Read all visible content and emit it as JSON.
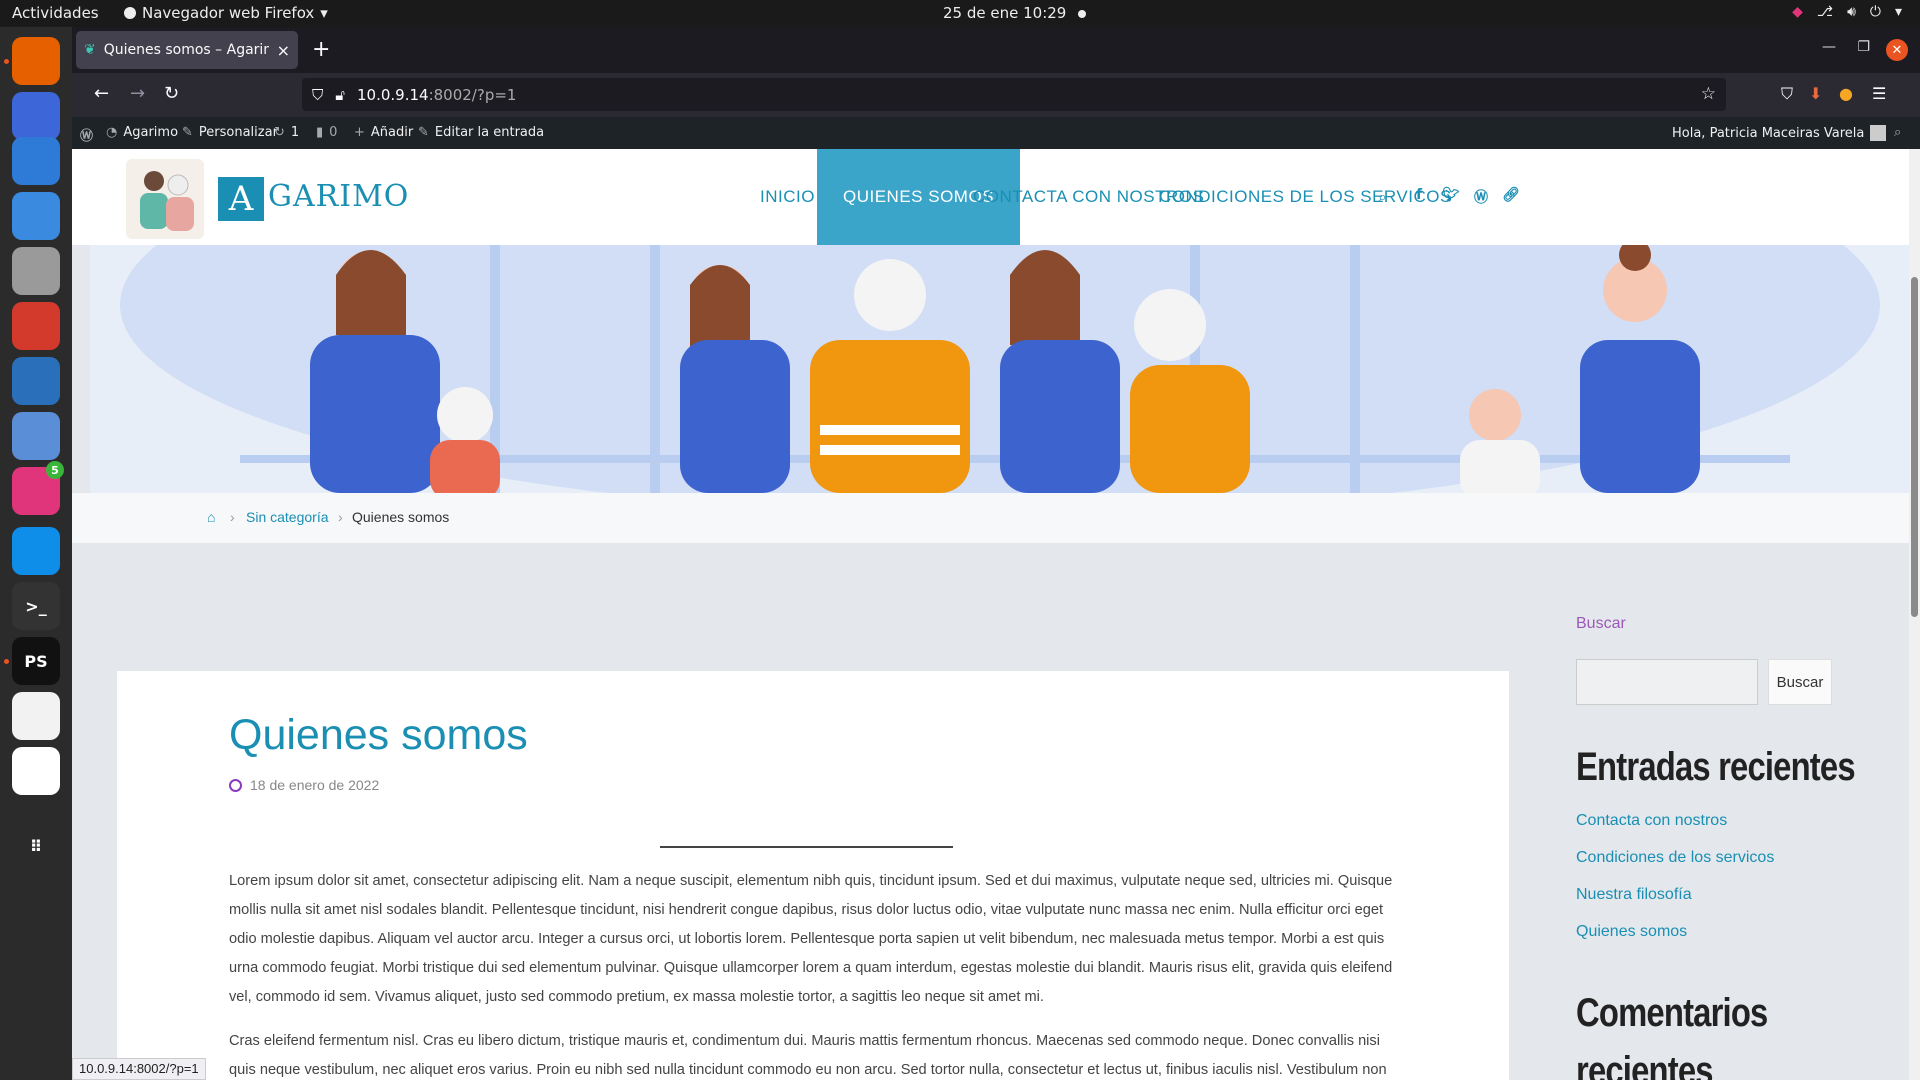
{
  "topbar": {
    "activities": "Actividades",
    "app_name": "Navegador web Firefox",
    "app_arrow": "▾",
    "clock": "25 de ene  10:29"
  },
  "dock": {
    "items": [
      {
        "name": "firefox",
        "label": "",
        "color": "#e66000"
      },
      {
        "name": "screenshot",
        "label": "",
        "color": "#3d66d8"
      },
      {
        "name": "document-viewer",
        "label": "",
        "color": "#2d7bd6"
      },
      {
        "name": "software-center",
        "label": "",
        "color": "#3a8be0"
      },
      {
        "name": "files",
        "label": "",
        "color": "#9a9a9a"
      },
      {
        "name": "chrome",
        "label": "",
        "color": "#d33a2c"
      },
      {
        "name": "system-monitor",
        "label": "",
        "color": "#2a6fb9"
      },
      {
        "name": "virtualbox",
        "label": "",
        "color": "#5a8ed6"
      },
      {
        "name": "jetbrains-toolbox",
        "label": "",
        "color": "#e0357a",
        "badge": "5"
      },
      {
        "name": "teamviewer",
        "label": "",
        "color": "#0e8ee9"
      },
      {
        "name": "terminal",
        "label": ">_",
        "color": "#333"
      },
      {
        "name": "phpstorm",
        "label": "PS",
        "color": "#111"
      },
      {
        "name": "text-editor",
        "label": "",
        "color": "#f2f2f2"
      },
      {
        "name": "android-studio",
        "label": "",
        "color": "#ffffff"
      },
      {
        "name": "app-grid",
        "label": "⠿",
        "color": "#2b2b2b"
      }
    ]
  },
  "browser": {
    "tab_title": "Quienes somos – Agarimo",
    "tab_close": "×",
    "new_tab": "+",
    "url_host": "10.0.9.14",
    "url_rest": ":8002/?p=1",
    "status_url": "10.0.9.14:8002/?p=1"
  },
  "wpbar": {
    "site": "Agarimo",
    "customize": "Personalizar",
    "updates": "1",
    "comments": "0",
    "add": "Añadir",
    "edit": "Editar la entrada",
    "greeting": "Hola, Patricia Maceiras Varela"
  },
  "site": {
    "logo_letter": "A",
    "logo_text": "GARIMO",
    "menu": [
      "INICIO",
      "QUIENES SOMOS",
      "CONTACTA CON NOSTROS",
      "CONDICIONES DE LOS SERVICOS"
    ],
    "active_menu": "QUIENES SOMOS"
  },
  "breadcrumb": {
    "category": "Sin categoría",
    "current": "Quienes somos",
    "sep": "›"
  },
  "post": {
    "title": "Quienes somos",
    "date": "18 de enero de 2022",
    "para1": "Lorem ipsum dolor sit amet, consectetur adipiscing elit. Nam a neque suscipit, elementum nibh quis, tincidunt ipsum. Sed et dui maximus, vulputate neque sed, ultricies mi. Quisque mollis nulla sit amet nisl sodales blandit. Pellentesque tincidunt, nisi hendrerit congue dapibus, risus dolor luctus odio, vitae vulputate nunc massa nec enim. Nulla efficitur orci eget odio molestie dapibus. Aliquam vel auctor arcu. Integer a cursus orci, ut lobortis lorem. Pellentesque porta sapien ut velit bibendum, nec malesuada metus tempor. Morbi a est quis urna commodo feugiat. Morbi tristique dui sed elementum pulvinar. Quisque ullamcorper lorem a quam interdum, egestas molestie dui blandit. Mauris risus elit, gravida quis eleifend vel, commodo id sem. Vivamus aliquet, justo sed commodo pretium, ex massa molestie tortor, a sagittis leo neque sit amet mi.",
    "para2": "Cras eleifend fermentum nisl. Cras eu libero dictum, tristique mauris et, condimentum dui. Mauris mattis fermentum rhoncus. Maecenas sed commodo neque. Donec convallis nisi quis neque vestibulum, nec aliquet eros varius. Proin eu nibh sed nulla tincidunt commodo eu non arcu. Sed tortor nulla, consectetur et lectus ut, finibus iaculis nisl. Vestibulum non tincidunt purus, eu facilisis nisl. Maecenas ex metus, aliquam vitae ullamcorper vitae, aliquet non metus. In quis congue risus. Praesent hendrerit metus in"
  },
  "sidebar": {
    "search_label": "Buscar",
    "search_button": "Buscar",
    "recent_title": "Entradas recientes",
    "recent": [
      "Contacta con nostros",
      "Condiciones de los servicos",
      "Nuestra filosofía",
      "Quienes somos"
    ],
    "comments_title_line1": "Comentarios",
    "comments_title_line2": "recientes"
  },
  "colors": {
    "accent": "#1a8fb3",
    "active_menu_bg": "#3ba4c9",
    "search_label": "#9b59b6"
  }
}
